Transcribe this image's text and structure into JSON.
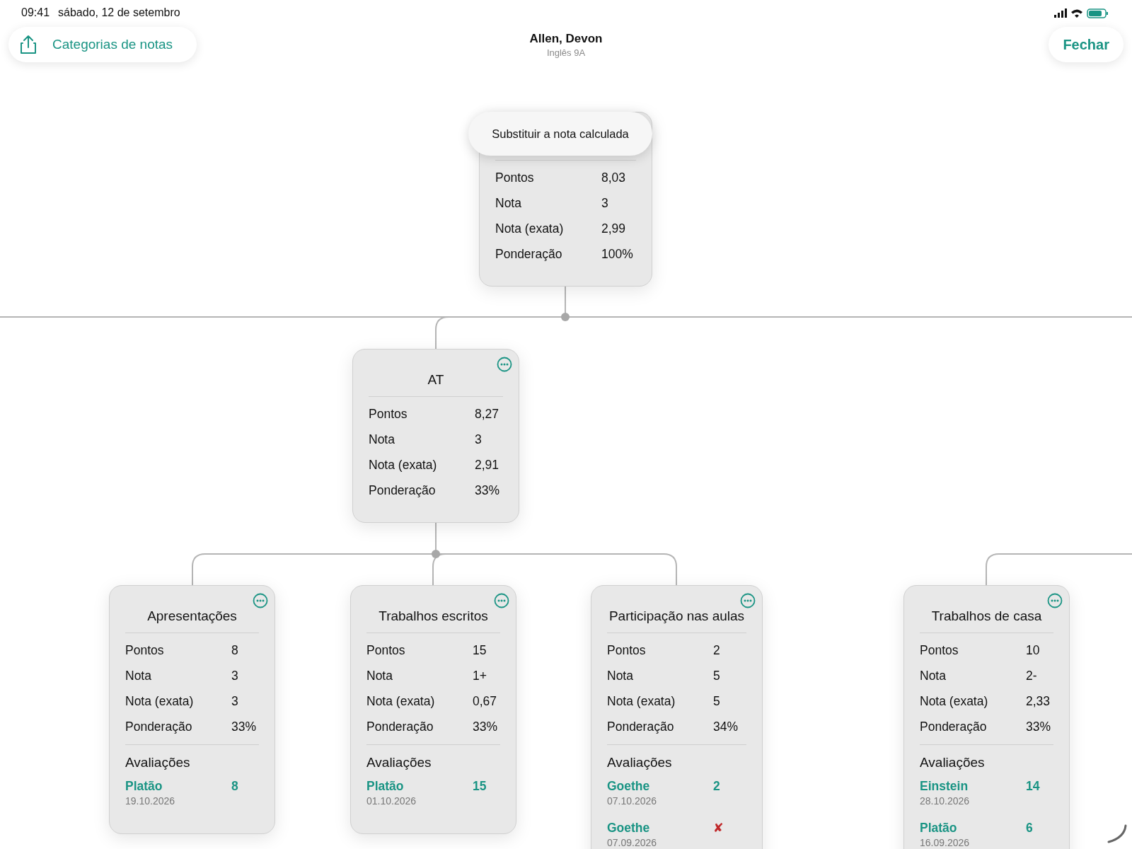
{
  "status_bar": {
    "time": "09:41",
    "date": "sábado, 12 de setembro"
  },
  "toolbar": {
    "categories_button": "Categorias de notas",
    "title": "Allen, Devon",
    "subtitle": "Inglês 9A",
    "close_button": "Fechar"
  },
  "tooltip": "Substituir a nota calculada",
  "root": {
    "rows": [
      {
        "label": "Pontos",
        "value": "8,03"
      },
      {
        "label": "Nota",
        "value": "3"
      },
      {
        "label": "Nota (exata)",
        "value": "2,99"
      },
      {
        "label": "Ponderação",
        "value": "100%"
      }
    ],
    "children": [
      {
        "title": "AT",
        "rows": [
          {
            "label": "Pontos",
            "value": "8,27"
          },
          {
            "label": "Nota",
            "value": "3"
          },
          {
            "label": "Nota (exata)",
            "value": "2,91"
          },
          {
            "label": "Ponderação",
            "value": "33%"
          }
        ],
        "children": [
          {
            "title": "Apresentações",
            "rows": [
              {
                "label": "Pontos",
                "value": "8"
              },
              {
                "label": "Nota",
                "value": "3"
              },
              {
                "label": "Nota (exata)",
                "value": "3"
              },
              {
                "label": "Ponderação",
                "value": "33%"
              }
            ],
            "evaluations_title": "Avaliações",
            "evaluations": [
              {
                "name": "Platão",
                "grade": "8",
                "kind": "grade",
                "date": "19.10.2026"
              }
            ]
          },
          {
            "title": "Trabalhos escritos",
            "rows": [
              {
                "label": "Pontos",
                "value": "15"
              },
              {
                "label": "Nota",
                "value": "1+"
              },
              {
                "label": "Nota (exata)",
                "value": "0,67"
              },
              {
                "label": "Ponderação",
                "value": "33%"
              }
            ],
            "evaluations_title": "Avaliações",
            "evaluations": [
              {
                "name": "Platão",
                "grade": "15",
                "kind": "grade",
                "date": "01.10.2026"
              }
            ]
          },
          {
            "title": "Participação nas aulas",
            "rows": [
              {
                "label": "Pontos",
                "value": "2"
              },
              {
                "label": "Nota",
                "value": "5"
              },
              {
                "label": "Nota (exata)",
                "value": "5"
              },
              {
                "label": "Ponderação",
                "value": "34%"
              }
            ],
            "evaluations_title": "Avaliações",
            "evaluations": [
              {
                "name": "Goethe",
                "grade": "2",
                "kind": "grade",
                "date": "07.10.2026"
              },
              {
                "name": "Goethe",
                "grade": "✘",
                "kind": "missing",
                "date": "07.09.2026"
              }
            ]
          }
        ]
      }
    ]
  },
  "other_cards": [
    {
      "title": "Trabalhos de casa",
      "rows": [
        {
          "label": "Pontos",
          "value": "10"
        },
        {
          "label": "Nota",
          "value": "2-"
        },
        {
          "label": "Nota (exata)",
          "value": "2,33"
        },
        {
          "label": "Ponderação",
          "value": "33%"
        }
      ],
      "evaluations_title": "Avaliações",
      "evaluations": [
        {
          "name": "Einstein",
          "grade": "14",
          "kind": "grade",
          "date": "28.10.2026"
        },
        {
          "name": "Platão",
          "grade": "6",
          "kind": "grade",
          "date": "16.09.2026"
        }
      ]
    }
  ]
}
